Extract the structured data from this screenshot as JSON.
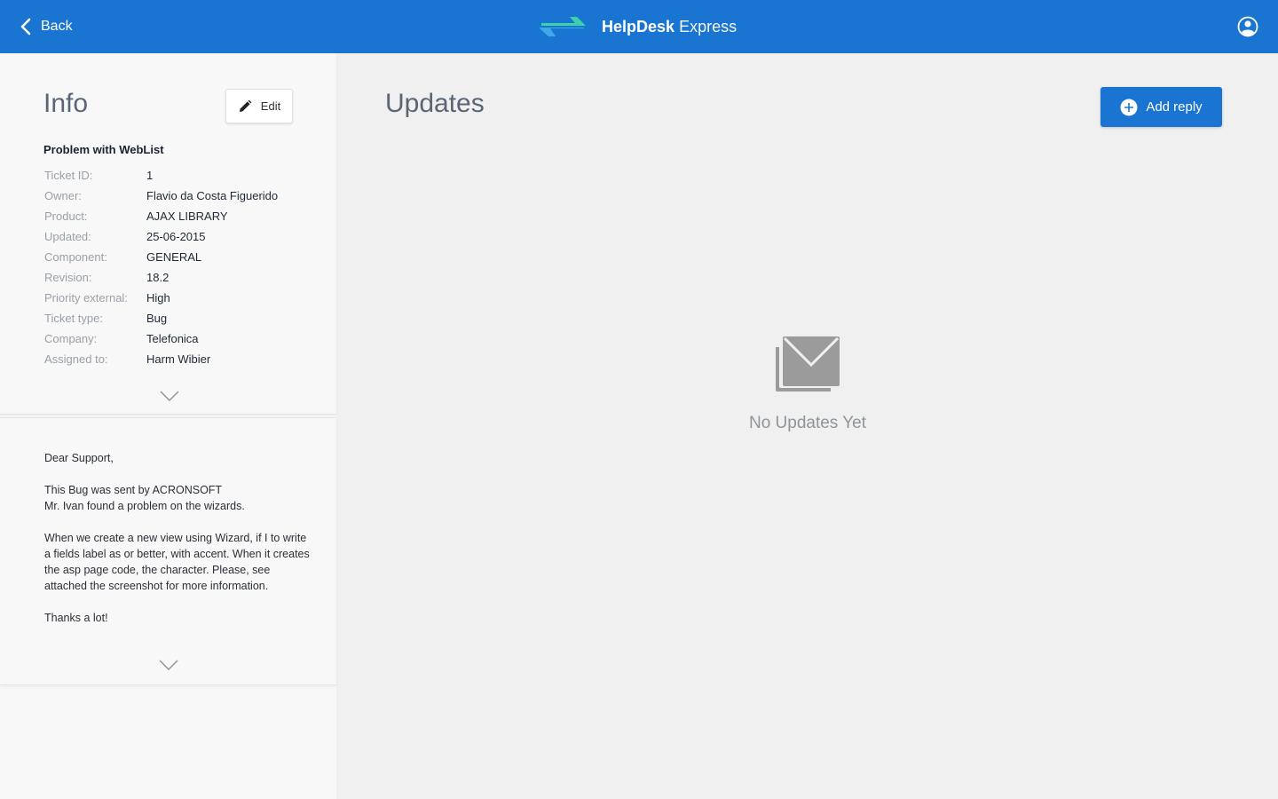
{
  "header": {
    "back_label": "Back",
    "brand_bold": "HelpDesk",
    "brand_light": "Express",
    "brand_color": "#1a75d2",
    "logo_colors": [
      "#3ed1a6",
      "#3fa9e8"
    ]
  },
  "info": {
    "title": "Info",
    "edit_label": "Edit",
    "ticket_title": "Problem with WebList",
    "fields": [
      {
        "label": "Ticket ID:",
        "value": "1"
      },
      {
        "label": "Owner:",
        "value": "Flavio da Costa Figuerido"
      },
      {
        "label": "Product:",
        "value": "AJAX LIBRARY"
      },
      {
        "label": "Updated:",
        "value": "25-06-2015"
      },
      {
        "label": "Component:",
        "value": "GENERAL"
      },
      {
        "label": "Revision:",
        "value": "18.2"
      },
      {
        "label": "Priority external:",
        "value": "High"
      },
      {
        "label": "Ticket type:",
        "value": "Bug"
      },
      {
        "label": "Company:",
        "value": "Telefonica"
      },
      {
        "label": "Assigned to:",
        "value": "Harm Wibier"
      }
    ]
  },
  "description": {
    "greeting": "Dear Support,",
    "para1_line1": "This Bug was sent by ACRONSOFT",
    "para1_line2": "Mr. Ivan found a problem on the wizards.",
    "para2": "When we create a new view using Wizard, if I to write a fields label as or better, with accent. When it creates the asp page code, the character. Please, see attached the screenshot for more information.",
    "closing": "Thanks a lot!"
  },
  "updates": {
    "title": "Updates",
    "add_reply_label": "Add reply",
    "empty_text": "No Updates Yet"
  }
}
